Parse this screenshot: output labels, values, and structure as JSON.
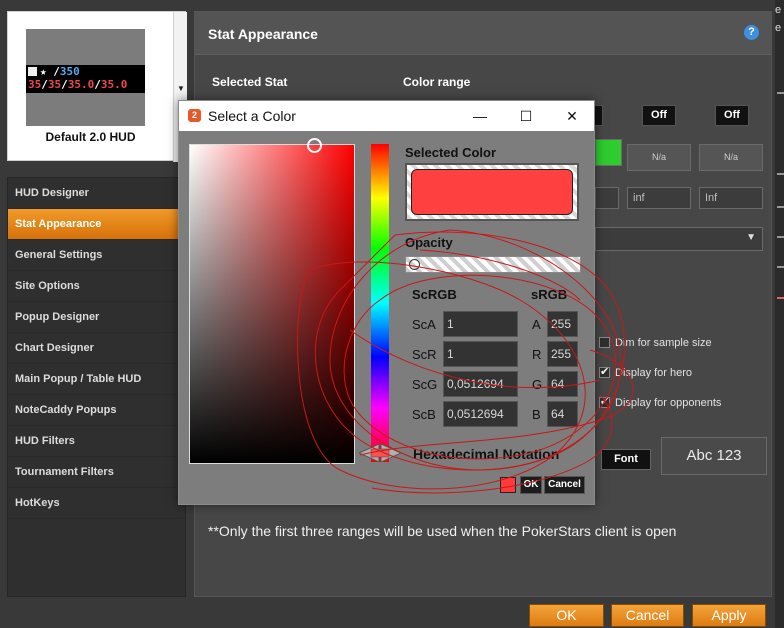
{
  "hud": {
    "preview_row1": [
      {
        "text": "★ ",
        "color": "white"
      },
      {
        "text": "/",
        "color": "white"
      },
      {
        "text": "350",
        "color": "blue"
      }
    ],
    "preview_row2": [
      {
        "text": "35",
        "color": "red"
      },
      {
        "text": "/",
        "color": "white"
      },
      {
        "text": "35",
        "color": "red"
      },
      {
        "text": "/",
        "color": "white"
      },
      {
        "text": "35.0",
        "color": "red"
      },
      {
        "text": "/",
        "color": "white"
      },
      {
        "text": "35.0",
        "color": "red"
      }
    ],
    "name": "Default 2.0 HUD"
  },
  "nav": {
    "items": [
      {
        "label": "HUD Designer",
        "active": false
      },
      {
        "label": "Stat Appearance",
        "active": true
      },
      {
        "label": "General Settings",
        "active": false
      },
      {
        "label": "Site Options",
        "active": false
      },
      {
        "label": "Popup Designer",
        "active": false
      },
      {
        "label": "Chart Designer",
        "active": false
      },
      {
        "label": "Main Popup / Table HUD",
        "active": false
      },
      {
        "label": "NoteCaddy Popups",
        "active": false
      },
      {
        "label": "HUD Filters",
        "active": false
      },
      {
        "label": "Tournament Filters",
        "active": false
      },
      {
        "label": "HotKeys",
        "active": false
      }
    ]
  },
  "panel": {
    "title": "Stat Appearance",
    "help": "?",
    "selected_stat_label": "Selected Stat",
    "color_range_label": "Color range",
    "off1": "Off",
    "off2": "Off",
    "na1": "N/a",
    "na2": "N/a",
    "inf1": "inf",
    "inf2": "Inf",
    "dim_label": "Dim for sample size",
    "dim_checked": false,
    "hero_label": "Display for hero",
    "hero_checked": true,
    "opp_label": "Display for opponents",
    "opp_checked": true,
    "font_button": "Font",
    "font_preview": "Abc 123",
    "note": "**Only the first three ranges will be used when the PokerStars client is open"
  },
  "footer": {
    "ok": "OK",
    "cancel": "Cancel",
    "apply": "Apply"
  },
  "dialog": {
    "title": "Select a Color",
    "app_icon_glyph": "2",
    "selected_color_label": "Selected Color",
    "opacity_label": "Opacity",
    "opacity_value": 0,
    "scrgb_label": "ScRGB",
    "srgb_label": "sRGB",
    "channels": [
      {
        "sc_label": "ScA",
        "sc_value": "1",
        "s_label": "A",
        "s_value": "255"
      },
      {
        "sc_label": "ScR",
        "sc_value": "1",
        "s_label": "R",
        "s_value": "255"
      },
      {
        "sc_label": "ScG",
        "sc_value": "0,0512694",
        "s_label": "G",
        "s_value": "64"
      },
      {
        "sc_label": "ScB",
        "sc_value": "0,0512694",
        "s_label": "B",
        "s_value": "64"
      }
    ],
    "hex_label": "Hexadecimal Notation",
    "ok": "OK",
    "cancel": "Cancel",
    "selected_color": "#ff4040"
  },
  "edge": {
    "fragment1": "e",
    "fragment2": "e"
  },
  "colors": {
    "accent": "#e8891d",
    "active_green": "#2ecc2e",
    "preview_red": "#f04848",
    "preview_blue": "#58a8f0"
  }
}
